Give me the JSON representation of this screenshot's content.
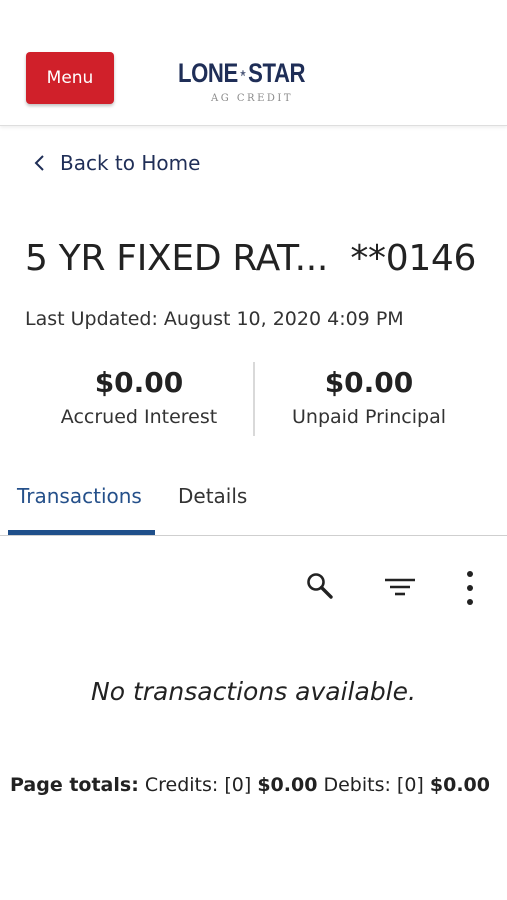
{
  "header": {
    "menu_label": "Menu",
    "logo_left": "LONE",
    "logo_right": "STAR",
    "logo_sub": "AG CREDIT",
    "brand_color": "#d0202a",
    "navy_color": "#1f2e57"
  },
  "nav": {
    "back_label": "Back to Home"
  },
  "account": {
    "title": "5 YR FIXED RAT...  **0146",
    "last_updated": "Last Updated: August 10, 2020 4:09 PM"
  },
  "balances": [
    {
      "amount": "$0.00",
      "label": "Accrued Interest"
    },
    {
      "amount": "$0.00",
      "label": "Unpaid Principal"
    }
  ],
  "tabs": [
    {
      "label": "Transactions",
      "active": true
    },
    {
      "label": "Details",
      "active": false
    }
  ],
  "toolbar": {
    "icons": [
      "search-icon",
      "filter-icon",
      "more-vertical-icon"
    ]
  },
  "transactions": {
    "empty_message": "No transactions available."
  },
  "totals": {
    "prefix": "Page totals:",
    "credits_label": "Credits: [0]",
    "credits_amount": "$0.00",
    "debits_label": "Debits: [0]",
    "debits_amount": "$0.00"
  }
}
